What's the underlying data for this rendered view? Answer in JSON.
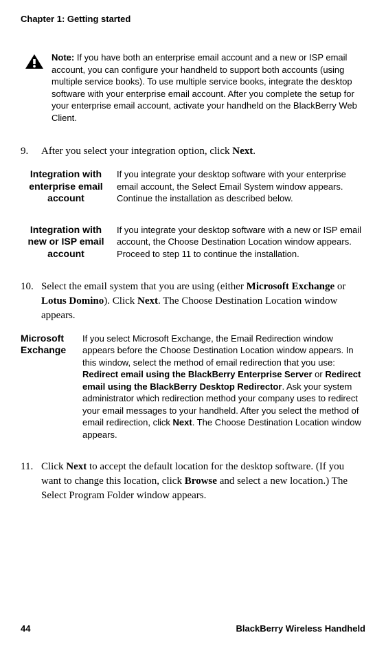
{
  "chapter_header": "Chapter 1: Getting started",
  "note": {
    "label": "Note:",
    "text": " If you have both an enterprise email account and a new or ISP email account, you can configure your handheld to support both accounts (using multiple service books). To use multiple service books, integrate the desktop software with your enterprise email account. After you complete the setup for your enterprise email account, activate your handheld on the BlackBerry Web Client."
  },
  "step9": {
    "num": "9.",
    "before": "After you select your integration option, click ",
    "bold1": "Next",
    "after": "."
  },
  "opt_enterprise": {
    "label": "Integration with enterprise email account",
    "text": "If you integrate your desktop software with your enterprise email account, the Select Email System window appears. Continue the installation as described below."
  },
  "opt_isp": {
    "label": "Integration with new or ISP email account",
    "text": "If you integrate your desktop software with a new or ISP email account, the Choose Destination Location window appears. Proceed to step 11 to continue the installation."
  },
  "step10": {
    "num": "10.",
    "t1": "Select the email system that you are using (either ",
    "b1": "Microsoft Exchange",
    "t2": " or ",
    "b2": "Lotus Domino",
    "t3": "). Click ",
    "b3": "Next",
    "t4": ". The Choose Destination Location window appears."
  },
  "opt_exchange": {
    "label": "Microsoft Exchange",
    "t1": "If you select Microsoft Exchange, the Email Redirection window appears before the Choose Destination Location window appears. In this window, select the method of email redirection that you use: ",
    "b1": "Redirect email using the BlackBerry Enterprise Server",
    "t2": " or ",
    "b2": "Redirect email using the BlackBerry Desktop Redirector",
    "t3": ". Ask your system administrator which redirection method your company uses to redirect your email messages to your handheld. After you select the method of email redirection, click ",
    "b3": "Next",
    "t4": ". The Choose Destination Location window appears."
  },
  "step11": {
    "num": "11.",
    "t1": "Click ",
    "b1": "Next",
    "t2": " to accept the default location for the desktop software. (If you want to change this location, click ",
    "b2": "Browse",
    "t3": " and select a new location.) The Select Program Folder window appears."
  },
  "footer": {
    "page": "44",
    "product": "BlackBerry Wireless Handheld"
  }
}
